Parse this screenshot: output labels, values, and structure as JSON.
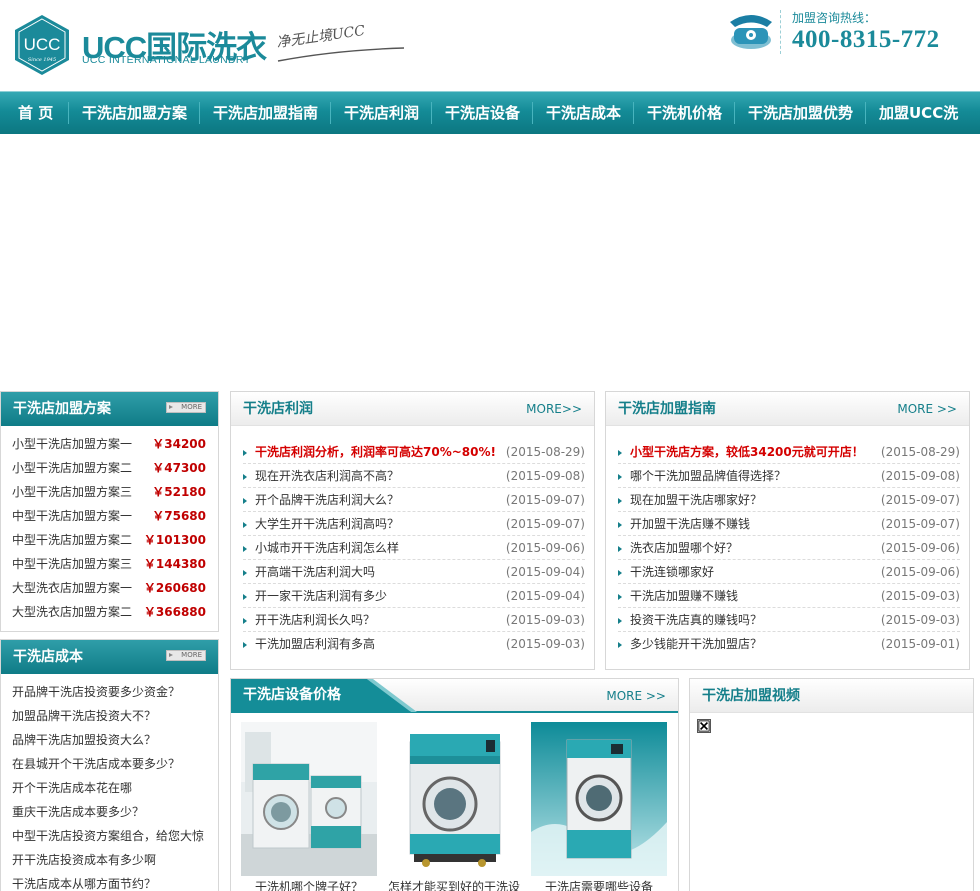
{
  "header": {
    "logo_mark": "UCC",
    "logo_since": "Since 1945",
    "brand_name": "UCC国际洗衣",
    "brand_sub": "UCC INTERNATIONAL LAUNDRY",
    "slogan": "净无止境UCC",
    "hotline_label": "加盟咨询热线：",
    "hotline_number": "400-8315-772"
  },
  "nav": {
    "items": [
      "首 页",
      "干洗店加盟方案",
      "干洗店加盟指南",
      "干洗店利润",
      "干洗店设备",
      "干洗店成本",
      "干洗机价格",
      "干洗店加盟优势",
      "加盟UCC洗"
    ]
  },
  "plans": {
    "title": "干洗店加盟方案",
    "more": "MORE",
    "rows": [
      {
        "name": "小型干洗店加盟方案一",
        "price": "￥34200"
      },
      {
        "name": "小型干洗店加盟方案二",
        "price": "￥47300"
      },
      {
        "name": "小型干洗店加盟方案三",
        "price": "￥52180"
      },
      {
        "name": "中型干洗店加盟方案一",
        "price": "￥75680"
      },
      {
        "name": "中型干洗店加盟方案二",
        "price": "￥101300"
      },
      {
        "name": "中型干洗店加盟方案三",
        "price": "￥144380"
      },
      {
        "name": "大型洗衣店加盟方案一",
        "price": "￥260680"
      },
      {
        "name": "大型洗衣店加盟方案二",
        "price": "￥366880"
      }
    ]
  },
  "cost": {
    "title": "干洗店成本",
    "more": "MORE",
    "items": [
      "开品牌干洗店投资要多少资金？",
      "加盟品牌干洗店投资大不？",
      "品牌干洗店加盟投资大么？",
      "在县城开个干洗店成本要多少？",
      "开个干洗店成本花在哪",
      "重庆干洗店成本要多少？",
      "中型干洗店投资方案组合，给您大惊",
      "开干洗店投资成本有多少啊",
      "干洗店成本从哪方面节约？"
    ]
  },
  "profit": {
    "title": "干洗店利润",
    "more": "MORE>>",
    "items": [
      {
        "text": "干洗店利润分析，利润率可高达70%~80%!",
        "date": "(2015-08-29)",
        "hot": true
      },
      {
        "text": "现在开洗衣店利润高不高？",
        "date": "(2015-09-08)",
        "hot": false
      },
      {
        "text": "开个品牌干洗店利润大么？",
        "date": "(2015-09-07)",
        "hot": false
      },
      {
        "text": "大学生开干洗店利润高吗？",
        "date": "(2015-09-07)",
        "hot": false
      },
      {
        "text": "小城市开干洗店利润怎么样",
        "date": "(2015-09-06)",
        "hot": false
      },
      {
        "text": "开高端干洗店利润大吗",
        "date": "(2015-09-04)",
        "hot": false
      },
      {
        "text": "开一家干洗店利润有多少",
        "date": "(2015-09-04)",
        "hot": false
      },
      {
        "text": "开干洗店利润长久吗？",
        "date": "(2015-09-03)",
        "hot": false
      },
      {
        "text": "干洗加盟店利润有多高",
        "date": "(2015-09-03)",
        "hot": false
      }
    ]
  },
  "guide": {
    "title": "干洗店加盟指南",
    "more": "MORE >>",
    "items": [
      {
        "text": "小型干洗店方案，较低34200元就可开店！",
        "date": "(2015-08-29)",
        "hot": true
      },
      {
        "text": "哪个干洗加盟品牌值得选择？",
        "date": "(2015-09-08)",
        "hot": false
      },
      {
        "text": "现在加盟干洗店哪家好？",
        "date": "(2015-09-07)",
        "hot": false
      },
      {
        "text": "开加盟干洗店赚不赚钱",
        "date": "(2015-09-07)",
        "hot": false
      },
      {
        "text": "洗衣店加盟哪个好？",
        "date": "(2015-09-06)",
        "hot": false
      },
      {
        "text": "干洗连锁哪家好",
        "date": "(2015-09-06)",
        "hot": false
      },
      {
        "text": "干洗店加盟赚不赚钱",
        "date": "(2015-09-03)",
        "hot": false
      },
      {
        "text": "投资干洗店真的赚钱吗？",
        "date": "(2015-09-03)",
        "hot": false
      },
      {
        "text": "多少钱能开干洗加盟店？",
        "date": "(2015-09-01)",
        "hot": false
      }
    ]
  },
  "equipment": {
    "title": "干洗店设备价格",
    "more": "MORE >>",
    "products": [
      "干洗机哪个牌子好？",
      "怎样才能买到好的干洗设",
      "干洗店需要哪些设备"
    ]
  },
  "video": {
    "title": "干洗店加盟视频"
  },
  "colors": {
    "brand": "#1b8a9a",
    "nav": "#148b97",
    "price": "#c00000",
    "hot": "#d40000"
  }
}
